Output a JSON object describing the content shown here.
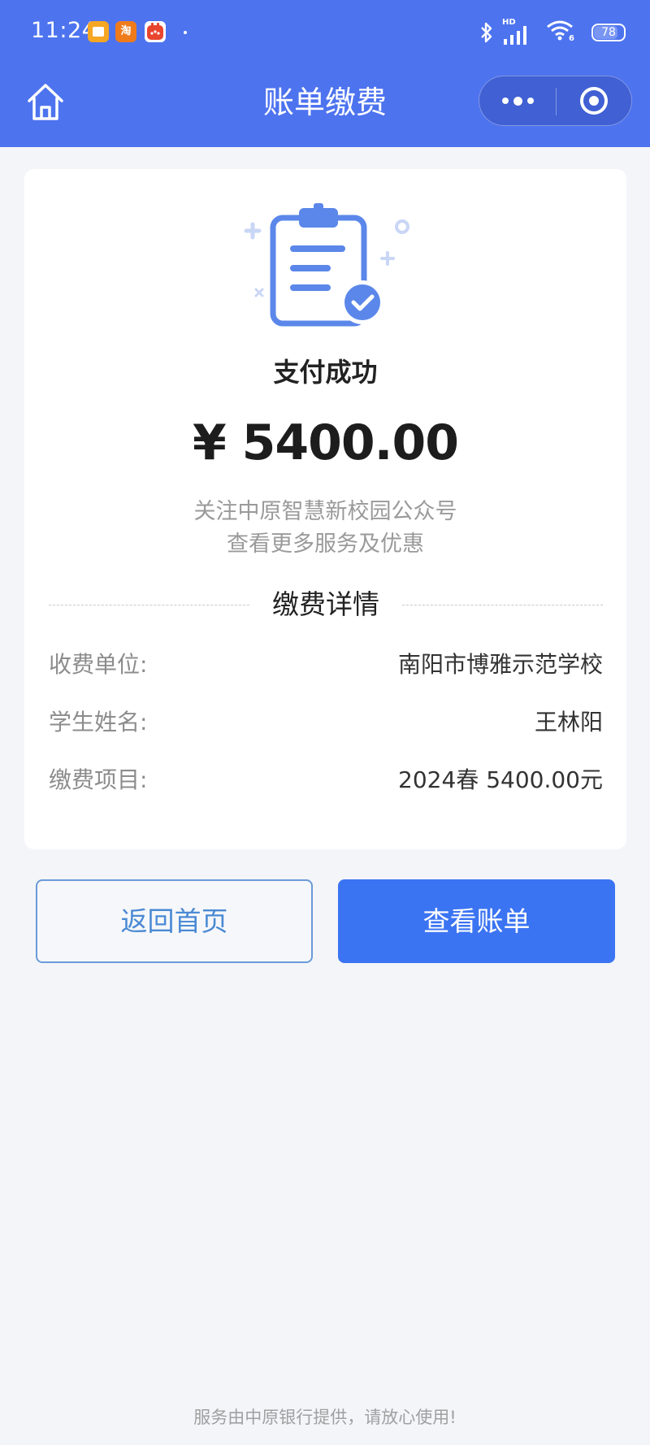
{
  "status_bar": {
    "time": "11:24",
    "app_badges": [
      {
        "icon": "notes-app-icon",
        "label": "",
        "color": "#f5a623"
      },
      {
        "icon": "taobao-app-icon",
        "label": "淘",
        "color": "#f07b1b"
      },
      {
        "icon": "calendar-app-icon",
        "label": "",
        "color": "#e8452e"
      }
    ],
    "network_label": "HD",
    "wifi_label": "6",
    "battery": "78"
  },
  "nav": {
    "title": "账单缴费",
    "home_icon": "home-icon",
    "more_icon": "more-dots-icon",
    "close_icon": "target-circle-icon"
  },
  "result": {
    "icon": "clipboard-check-icon",
    "title": "支付成功",
    "amount": "¥ 5400.00",
    "promo_line1": "关注中原智慧新校园公众号",
    "promo_line2": "查看更多服务及优惠"
  },
  "details": {
    "section_title": "缴费详情",
    "rows": [
      {
        "label": "收费单位:",
        "value": "南阳市博雅示范学校"
      },
      {
        "label": "学生姓名:",
        "value": "王林阳"
      },
      {
        "label": "缴费项目:",
        "value": "2024春 5400.00元"
      }
    ]
  },
  "actions": {
    "home_label": "返回首页",
    "bill_label": "查看账单"
  },
  "footer": "服务由中原银行提供，请放心使用!",
  "colors": {
    "header": "#4d73ef",
    "primary_button": "#3b74f2",
    "icon_blue": "#5b87ea",
    "background": "#f3f5f9"
  }
}
